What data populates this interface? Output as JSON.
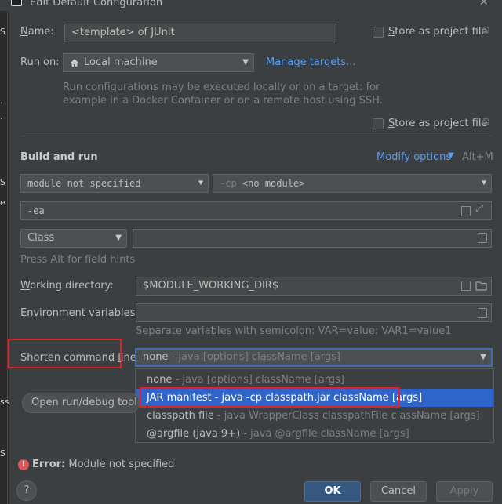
{
  "window": {
    "title": "Edit Default Configuration",
    "close_symbol": "✕"
  },
  "strip_fragments": [
    "S",
    ".",
    ".",
    "e",
    "S",
    "ss",
    "S"
  ],
  "name": {
    "label_mnemonic": "N",
    "label_rest": "ame:",
    "value": "<template> of JUnit",
    "store_label_mnemonic": "S",
    "store_label_rest": "tore as project file"
  },
  "run_on": {
    "label": "Run on:",
    "target": "Local machine",
    "manage_link": "Manage targets...",
    "hint_line1": "Run configurations may be executed locally or on a target: for",
    "hint_line2": "example in a Docker Container or on a remote host using SSH.",
    "store_label_mnemonic": "S",
    "store_label_rest": "tore as project file"
  },
  "build_and_run": {
    "heading": "Build and run",
    "modify_mnemonic": "M",
    "modify_rest": "odify options",
    "modify_shortcut": "Alt+M",
    "module": "module not specified",
    "cp_prefix": "-cp",
    "cp_value": "<no module>",
    "vm_options": "-ea",
    "test_kind": "Class",
    "class_value": "",
    "field_hints": "Press Alt for field hints"
  },
  "working_directory": {
    "label_mnemonic": "W",
    "label_rest": "orking directory:",
    "value": "$MODULE_WORKING_DIR$"
  },
  "environment_variables": {
    "label_mnemonic": "E",
    "label_rest": "nvironment variables:",
    "value": "",
    "hint": "Separate variables with semicolon: VAR=value; VAR1=value1"
  },
  "shorten_command_line": {
    "label_prefix": "Shorten command ",
    "label_mnemonic": "l",
    "label_rest": "ine:",
    "selected_main": "none",
    "selected_sub": " - java [options] className [args]",
    "options": [
      {
        "main": "none",
        "sub": " - java [options] className [args]"
      },
      {
        "main": "JAR manifest",
        "sub": " - java -cp classpath.jar className [args]"
      },
      {
        "main": "classpath file",
        "sub": " - java WrapperClass classpathFile className [args]"
      },
      {
        "main": "@argfile (Java 9+)",
        "sub": " - java @argfile className [args]"
      }
    ]
  },
  "open_run_debug": {
    "label": "Open run/debug tool"
  },
  "error": {
    "prefix": "Error:",
    "message": " Module not specified",
    "icon_glyph": "!"
  },
  "buttons": {
    "help_glyph": "?",
    "ok": "OK",
    "cancel": "Cancel",
    "apply_mnemonic": "A",
    "apply_rest": "pply"
  },
  "colors": {
    "dialog_bg": "#3c3f41",
    "accent_link": "#589df6",
    "selection": "#2f65ca",
    "highlight_box": "#e0202a",
    "error": "#e05555",
    "primary_button": "#365880"
  }
}
